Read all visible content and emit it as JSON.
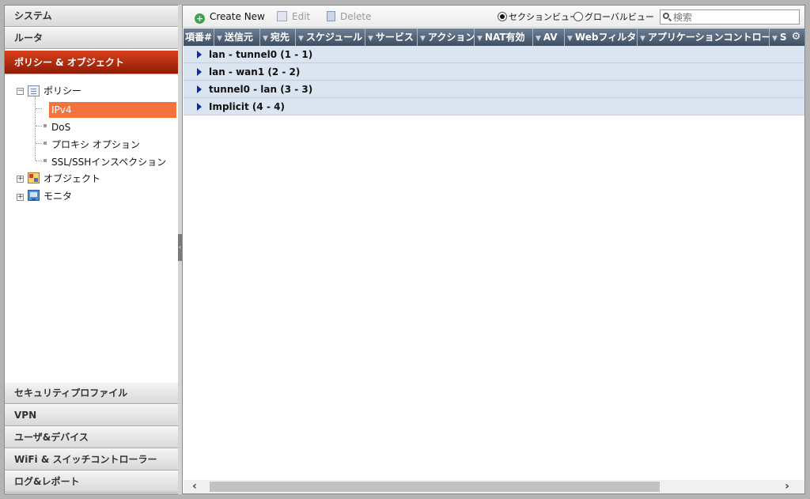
{
  "sidebar": {
    "categories_top": [
      "システム",
      "ルータ"
    ],
    "active_category": "ポリシー & オブジェクト",
    "categories_bottom": [
      "セキュリティプロファイル",
      "VPN",
      "ユーザ&デバイス",
      "WiFi & スイッチコントローラー",
      "ログ&レポート"
    ],
    "tree": {
      "policy": "ポリシー",
      "ipv4": "IPv4",
      "dos": "DoS",
      "proxy_option": "プロキシ オプション",
      "ssl_inspection": "SSL/SSHインスペクション",
      "objects": "オブジェクト",
      "monitor": "モニタ"
    }
  },
  "toolbar": {
    "create_new": "Create New",
    "edit": "Edit",
    "delete": "Delete",
    "section_view": "セクションビュー",
    "global_view": "グローバルビュー",
    "search_placeholder": "検索"
  },
  "grid": {
    "columns": [
      "項番#",
      "送信元",
      "宛先",
      "スケジュール",
      "サービス",
      "アクション",
      "NAT有効",
      "AV",
      "Webフィルタ",
      "アプリケーションコントロール",
      "S"
    ],
    "sections": [
      "lan - tunnel0 (1 - 1)",
      "lan - wan1 (2 - 2)",
      "tunnel0 - lan (3 - 3)",
      "Implicit (4 - 4)"
    ]
  },
  "colors": {
    "active_category": "#b82a0c",
    "selected_item": "#f4733d",
    "grid_header": "#56677b",
    "section_row": "#dbe5f1"
  }
}
